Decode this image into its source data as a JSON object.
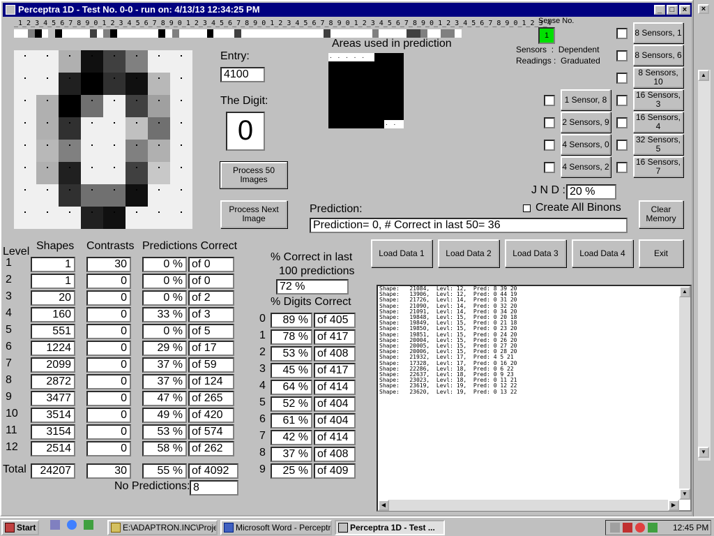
{
  "window": {
    "title": "Perceptra 1D - Test No. 0-0 - run on: 4/13/13  12:34:25 PM"
  },
  "ruler": {
    "digits": "_1_2_3_4_5_6_7_8_9_0_1_2_3_4_5_6_7_8_9_0_1_2_3_4_5_6_7_8_9_0_1_2_3_4_5_6_7_8_9_0_1_2_3_4_5_6_7_8_9_0_1_2_3_4_5_6_7_8_9_0_1_2_3_4",
    "cells": [
      "#fff",
      "#fff",
      "#808080",
      "#000",
      "#fff",
      "#c0c0c0",
      "#000",
      "#fff",
      "#fff",
      "#fff",
      "#fff",
      "#404040",
      "#fff",
      "#808080",
      "#000",
      "#fff",
      "#fff",
      "#fff",
      "#fff",
      "#fff",
      "#fff",
      "#000",
      "#fff",
      "#808080",
      "#fff",
      "#fff",
      "#fff",
      "#fff",
      "#000",
      "#fff",
      "#fff",
      "#fff",
      "#404040",
      "#fff",
      "#fff",
      "#fff",
      "#fff",
      "#fff",
      "#fff",
      "#fff",
      "#fff",
      "#fff",
      "#fff",
      "#fff",
      "#fff",
      "#404040",
      "#fff",
      "#fff",
      "#fff",
      "#fff",
      "#fff",
      "#fff",
      "#808080",
      "#fff",
      "#fff",
      "#fff",
      "#fff",
      "#404040",
      "#404040",
      "#808080",
      "#fff",
      "#fff",
      "#808080",
      "#808080",
      "#fff"
    ]
  },
  "digit_pixels": [
    "#f0f0f0",
    "#f0f0f0",
    "#b0b0b0",
    "#101010",
    "#404040",
    "#808080",
    "#f0f0f0",
    "#f0f0f0",
    "#f0f0f0",
    "#f0f0f0",
    "#202020",
    "#000000",
    "#303030",
    "#101010",
    "#b8b8b8",
    "#f0f0f0",
    "#f0f0f0",
    "#b0b0b0",
    "#000000",
    "#707070",
    "#f0f0f0",
    "#404040",
    "#a0a0a0",
    "#f0f0f0",
    "#f0f0f0",
    "#b0b0b0",
    "#303030",
    "#f0f0f0",
    "#f0f0f0",
    "#c0c0c0",
    "#707070",
    "#f0f0f0",
    "#f0f0f0",
    "#b8b8b8",
    "#808080",
    "#f0f0f0",
    "#f0f0f0",
    "#808080",
    "#b0b0b0",
    "#f0f0f0",
    "#f0f0f0",
    "#b0b0b0",
    "#202020",
    "#f0f0f0",
    "#f0f0f0",
    "#404040",
    "#c8c8c8",
    "#f0f0f0",
    "#f0f0f0",
    "#f0f0f0",
    "#303030",
    "#707070",
    "#707070",
    "#101010",
    "#f0f0f0",
    "#f0f0f0",
    "#f0f0f0",
    "#f0f0f0",
    "#f0f0f0",
    "#202020",
    "#101010",
    "#f0f0f0",
    "#f0f0f0",
    "#f0f0f0"
  ],
  "entry": {
    "label": "Entry:",
    "value": "4100"
  },
  "digit": {
    "label": "The Digit:",
    "value": "0"
  },
  "buttons": {
    "process50": "Process 50 Images",
    "process_next": "Process Next Image",
    "clear_memory": "Clear Memory",
    "load1": "Load Data 1",
    "load2": "Load Data 2",
    "load3": "Load Data 3",
    "load4": "Load Data 4",
    "exit": "Exit"
  },
  "areas": {
    "title": "Areas used in prediction",
    "top_dots": ". . . . .",
    "bottom_dots": ". ."
  },
  "sense": {
    "label": "Sense No.",
    "value": "1",
    "sensors_line": "Sensors  :  Dependent",
    "readings_line": "Readings :  Graduated"
  },
  "sensor_buttons_right": [
    "8 Sensors, 1",
    "8 Sensors, 6",
    "8 Sensors, 10",
    "16 Sensors, 3",
    "16 Sensors, 4",
    "32 Sensors, 5",
    "16 Sensors, 7"
  ],
  "sensor_buttons_left": [
    "1 Sensor, 8",
    "2 Sensors, 9",
    "4 Sensors, 0",
    "4 Sensors, 2"
  ],
  "jnd": {
    "label": "J N D :",
    "value": "20 %"
  },
  "create_binons": "Create All Binons",
  "prediction": {
    "label": "Prediction:",
    "value": "Prediction= 0, # Correct in last 50= 36"
  },
  "levels_table": {
    "headers": [
      "Level",
      "Shapes",
      "Contrasts",
      "Predictions Correct"
    ],
    "rows": [
      {
        "level": "1",
        "shapes": "1",
        "contrasts": "30",
        "pct": "0 %",
        "of": "of 0"
      },
      {
        "level": "2",
        "shapes": "1",
        "contrasts": "0",
        "pct": "0 %",
        "of": "of 0"
      },
      {
        "level": "3",
        "shapes": "20",
        "contrasts": "0",
        "pct": "0 %",
        "of": "of 2"
      },
      {
        "level": "4",
        "shapes": "160",
        "contrasts": "0",
        "pct": "33 %",
        "of": "of 3"
      },
      {
        "level": "5",
        "shapes": "551",
        "contrasts": "0",
        "pct": "0 %",
        "of": "of 5"
      },
      {
        "level": "6",
        "shapes": "1224",
        "contrasts": "0",
        "pct": "29 %",
        "of": "of 17"
      },
      {
        "level": "7",
        "shapes": "2099",
        "contrasts": "0",
        "pct": "37 %",
        "of": "of 59"
      },
      {
        "level": "8",
        "shapes": "2872",
        "contrasts": "0",
        "pct": "37 %",
        "of": "of 124"
      },
      {
        "level": "9",
        "shapes": "3477",
        "contrasts": "0",
        "pct": "47 %",
        "of": "of 265"
      },
      {
        "level": "10",
        "shapes": "3514",
        "contrasts": "0",
        "pct": "49 %",
        "of": "of 420"
      },
      {
        "level": "11",
        "shapes": "3154",
        "contrasts": "0",
        "pct": "53 %",
        "of": "of 574"
      },
      {
        "level": "12",
        "shapes": "2514",
        "contrasts": "0",
        "pct": "58 %",
        "of": "of 262"
      }
    ],
    "total": {
      "label": "Total",
      "shapes": "24207",
      "contrasts": "30",
      "pct": "55 %",
      "of": "of 4092"
    },
    "no_predictions": {
      "label": "No Predictions:",
      "value": "8"
    }
  },
  "last100": {
    "label1": "% Correct in last",
    "label2": "100 predictions",
    "value": "72 %"
  },
  "digits_table": {
    "label": "% Digits Correct",
    "rows": [
      {
        "digit": "0",
        "pct": "89 %",
        "of": "of 405"
      },
      {
        "digit": "1",
        "pct": "78 %",
        "of": "of 417"
      },
      {
        "digit": "2",
        "pct": "53 %",
        "of": "of 408"
      },
      {
        "digit": "3",
        "pct": "45 %",
        "of": "of 417"
      },
      {
        "digit": "4",
        "pct": "64 %",
        "of": "of 414"
      },
      {
        "digit": "5",
        "pct": "52 %",
        "of": "of 404"
      },
      {
        "digit": "6",
        "pct": "61 %",
        "of": "of 404"
      },
      {
        "digit": "7",
        "pct": "42 %",
        "of": "of 414"
      },
      {
        "digit": "8",
        "pct": "37 %",
        "of": "of 408"
      },
      {
        "digit": "9",
        "pct": "25 %",
        "of": "of 409"
      }
    ]
  },
  "log_lines": [
    "Shape:   21084,  Levl: 12,  Pred: 8 39 20",
    "Shape:   13906,  Levl: 12,  Pred: 0 44 19",
    "Shape:   21726,  Levl: 14,  Pred: 0 31 20",
    "Shape:   21090,  Levl: 14,  Pred: 0 32 20",
    "Shape:   21091,  Levl: 14,  Pred: 0 34 20",
    "Shape:   19848,  Levl: 15,  Pred: 0 20 18",
    "Shape:   19849,  Levl: 15,  Pred: 0 21 18",
    "Shape:   19850,  Levl: 15,  Pred: 0 23 20",
    "Shape:   19851,  Levl: 15,  Pred: 0 24 20",
    "Shape:   20004,  Levl: 15,  Pred: 0 26 20",
    "Shape:   20005,  Levl: 15,  Pred: 0 27 20",
    "Shape:   20006,  Levl: 15,  Pred: 0 28 20",
    "Shape:   21932,  Levl: 17,  Pred: 4 5 21",
    "Shape:   17328,  Levl: 17,  Pred: 0 16 20",
    "Shape:   22286,  Levl: 18,  Pred: 0 6 22",
    "Shape:   22637,  Levl: 18,  Pred: 0 9 23",
    "Shape:   23023,  Levl: 18,  Pred: 0 11 21",
    "Shape:   23619,  Levl: 19,  Pred: 0 12 22",
    "Shape:   23620,  Levl: 19,  Pred: 0 13 22"
  ],
  "taskbar": {
    "start": "Start",
    "tasks": [
      "E:\\ADAPTRON.INC\\Proje...",
      "Microsoft Word - Perceptra...",
      "Perceptra 1D - Test ..."
    ],
    "clock": "12:45 PM"
  }
}
